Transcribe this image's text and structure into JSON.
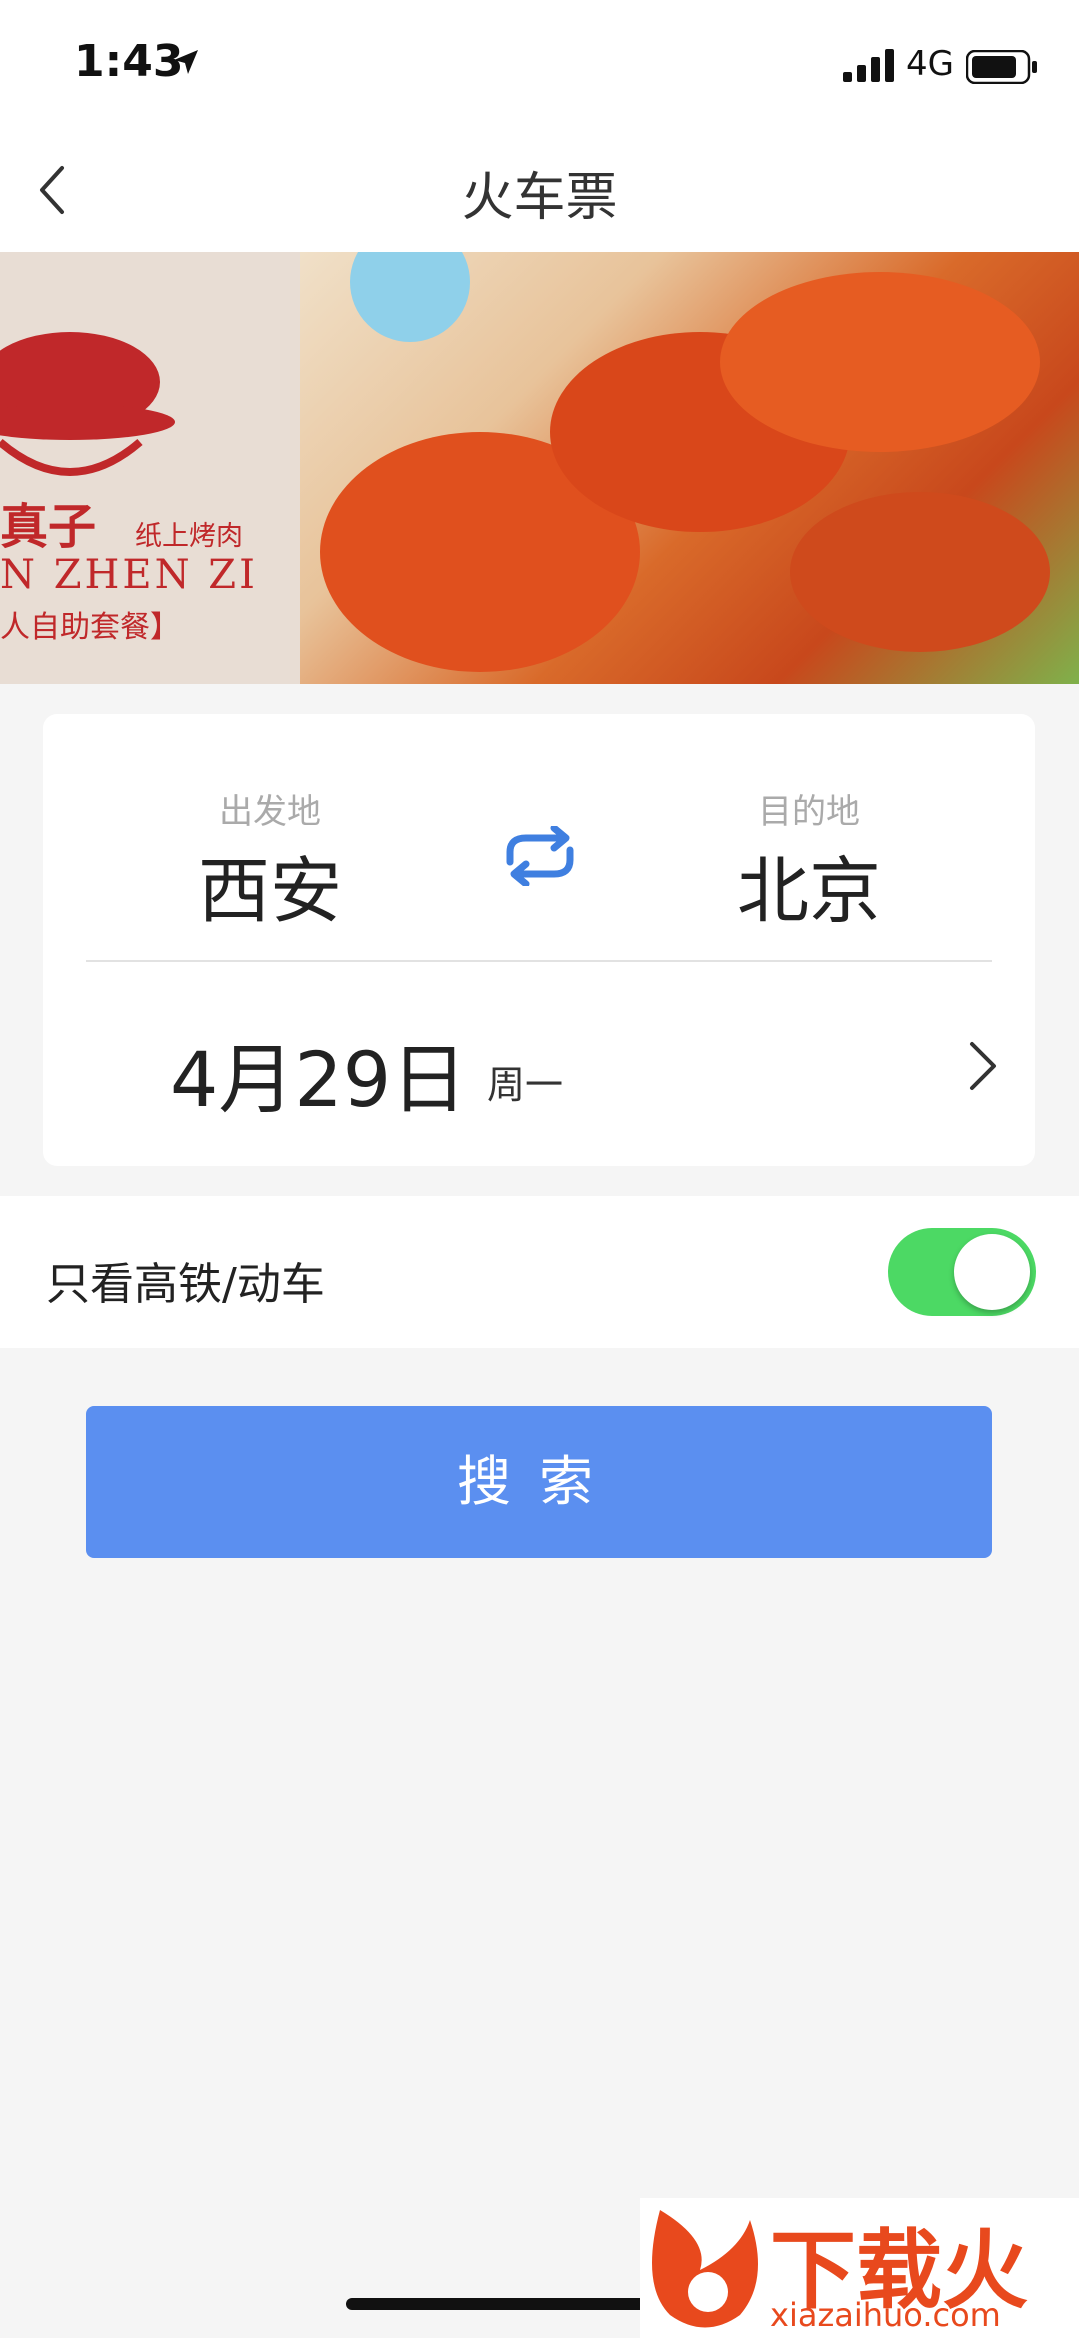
{
  "status": {
    "time": "1:43",
    "network": "4G"
  },
  "nav": {
    "title": "火车票"
  },
  "banner": {
    "brand_name": "真子",
    "brand_sub": "纸上烤肉",
    "brand_en": "N ZHEN ZI",
    "brand_tag": "人自助套餐】"
  },
  "trip": {
    "from_label": "出发地",
    "from_city": "西安",
    "to_label": "目的地",
    "to_city": "北京",
    "date": "4月29日",
    "weekday": "周一"
  },
  "filter": {
    "label": "只看高铁/动车",
    "enabled": true
  },
  "search": {
    "label": "搜索"
  },
  "watermark": {
    "text": "下载火",
    "url": "xiazaihuo.com"
  },
  "colors": {
    "accent": "#5b8ff0",
    "toggle_on": "#4cd964",
    "swap_icon": "#3f7fe0"
  }
}
